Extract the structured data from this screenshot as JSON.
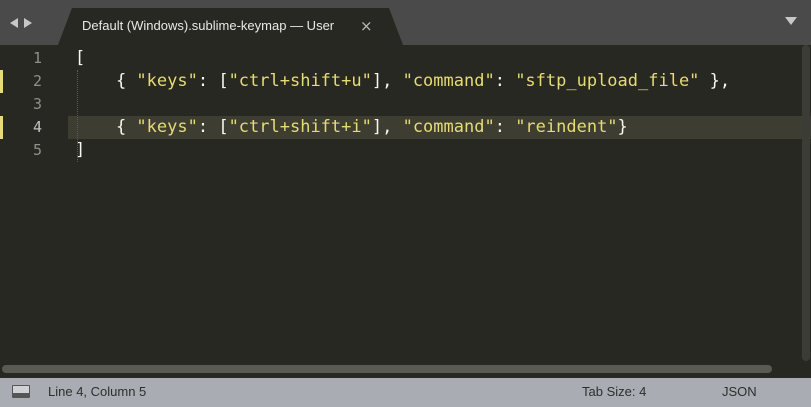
{
  "tabs": {
    "active_title": "Default (Windows).sublime-keymap — User",
    "close_glyph": "×"
  },
  "editor": {
    "line_numbers": [
      "1",
      "2",
      "3",
      "4",
      "5"
    ],
    "active_line": 4,
    "modified_lines": [
      2,
      4
    ],
    "lines": [
      {
        "parts": [
          {
            "t": "[",
            "c": "plain"
          }
        ]
      },
      {
        "parts": [
          {
            "t": "    { ",
            "c": "plain"
          },
          {
            "t": "\"keys\"",
            "c": "str"
          },
          {
            "t": ": [",
            "c": "plain"
          },
          {
            "t": "\"ctrl+shift+u\"",
            "c": "str"
          },
          {
            "t": "], ",
            "c": "plain"
          },
          {
            "t": "\"command\"",
            "c": "str"
          },
          {
            "t": ": ",
            "c": "plain"
          },
          {
            "t": "\"sftp_upload_file\"",
            "c": "str"
          },
          {
            "t": " },",
            "c": "plain"
          }
        ]
      },
      {
        "parts": []
      },
      {
        "parts": [
          {
            "t": "    { ",
            "c": "plain"
          },
          {
            "t": "\"keys\"",
            "c": "str"
          },
          {
            "t": ": [",
            "c": "plain"
          },
          {
            "t": "\"ctrl+shift+i\"",
            "c": "str"
          },
          {
            "t": "], ",
            "c": "plain"
          },
          {
            "t": "\"command\"",
            "c": "str"
          },
          {
            "t": ": ",
            "c": "plain"
          },
          {
            "t": "\"reindent\"",
            "c": "str"
          },
          {
            "t": "}",
            "c": "plain"
          }
        ]
      },
      {
        "parts": [
          {
            "t": "]",
            "c": "plain"
          }
        ]
      }
    ]
  },
  "status": {
    "position": "Line 4, Column 5",
    "tab_size": "Tab Size: 4",
    "syntax": "JSON"
  },
  "colors": {
    "background": "#272822",
    "string": "#e6db74",
    "text": "#f8f8f2",
    "statusbar": "#a9acb2"
  }
}
